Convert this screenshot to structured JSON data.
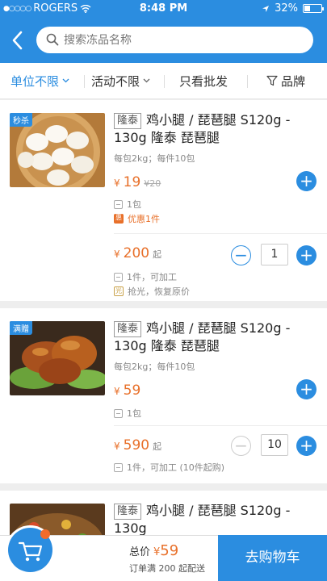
{
  "status_bar": {
    "carrier": "ROGERS",
    "time": "8:48 PM",
    "battery": "32%"
  },
  "header": {
    "search_placeholder": "搜索冻品名称"
  },
  "filters": [
    {
      "label": "单位不限",
      "active": true
    },
    {
      "label": "活动不限",
      "active": false
    },
    {
      "label": "只看批发",
      "active": false
    },
    {
      "label": "品牌",
      "active": false
    }
  ],
  "products": [
    {
      "tag": "秒杀",
      "brand": "隆泰",
      "title": "鸡小腿 / 琵琶腿 S120g - 130g 隆泰  琵琶腿",
      "spec": "每包2kg；每件10包",
      "price_currency": "¥",
      "price": "19",
      "orig_price": "¥20",
      "unit_info": "1包",
      "promo": "优惠1件",
      "bulk_price": "200",
      "bulk_suffix": "起",
      "quantity": "1",
      "bulk_unit": "1件，可加工",
      "bulk_note": "抢光，恢复原价"
    },
    {
      "tag": "满赠",
      "brand": "隆泰",
      "title": "鸡小腿 / 琵琶腿 S120g - 130g 隆泰  琵琶腿",
      "spec": "每包2kg；每件10包",
      "price_currency": "¥",
      "price": "59",
      "unit_info": "1包",
      "bulk_price": "590",
      "bulk_suffix": "起",
      "quantity": "10",
      "bulk_unit": "1件，可加工 (10件起购)"
    },
    {
      "brand": "隆泰",
      "title": "鸡小腿 / 琵琶腿 S120g - 130g"
    }
  ],
  "bottom": {
    "total_label": "总价",
    "currency": "¥",
    "total_amount": "59",
    "note": "订单满 200 起配送",
    "checkout_label": "去购物车"
  },
  "colors": {
    "brand_blue": "#2b8de0",
    "price_orange": "#e8702a"
  }
}
